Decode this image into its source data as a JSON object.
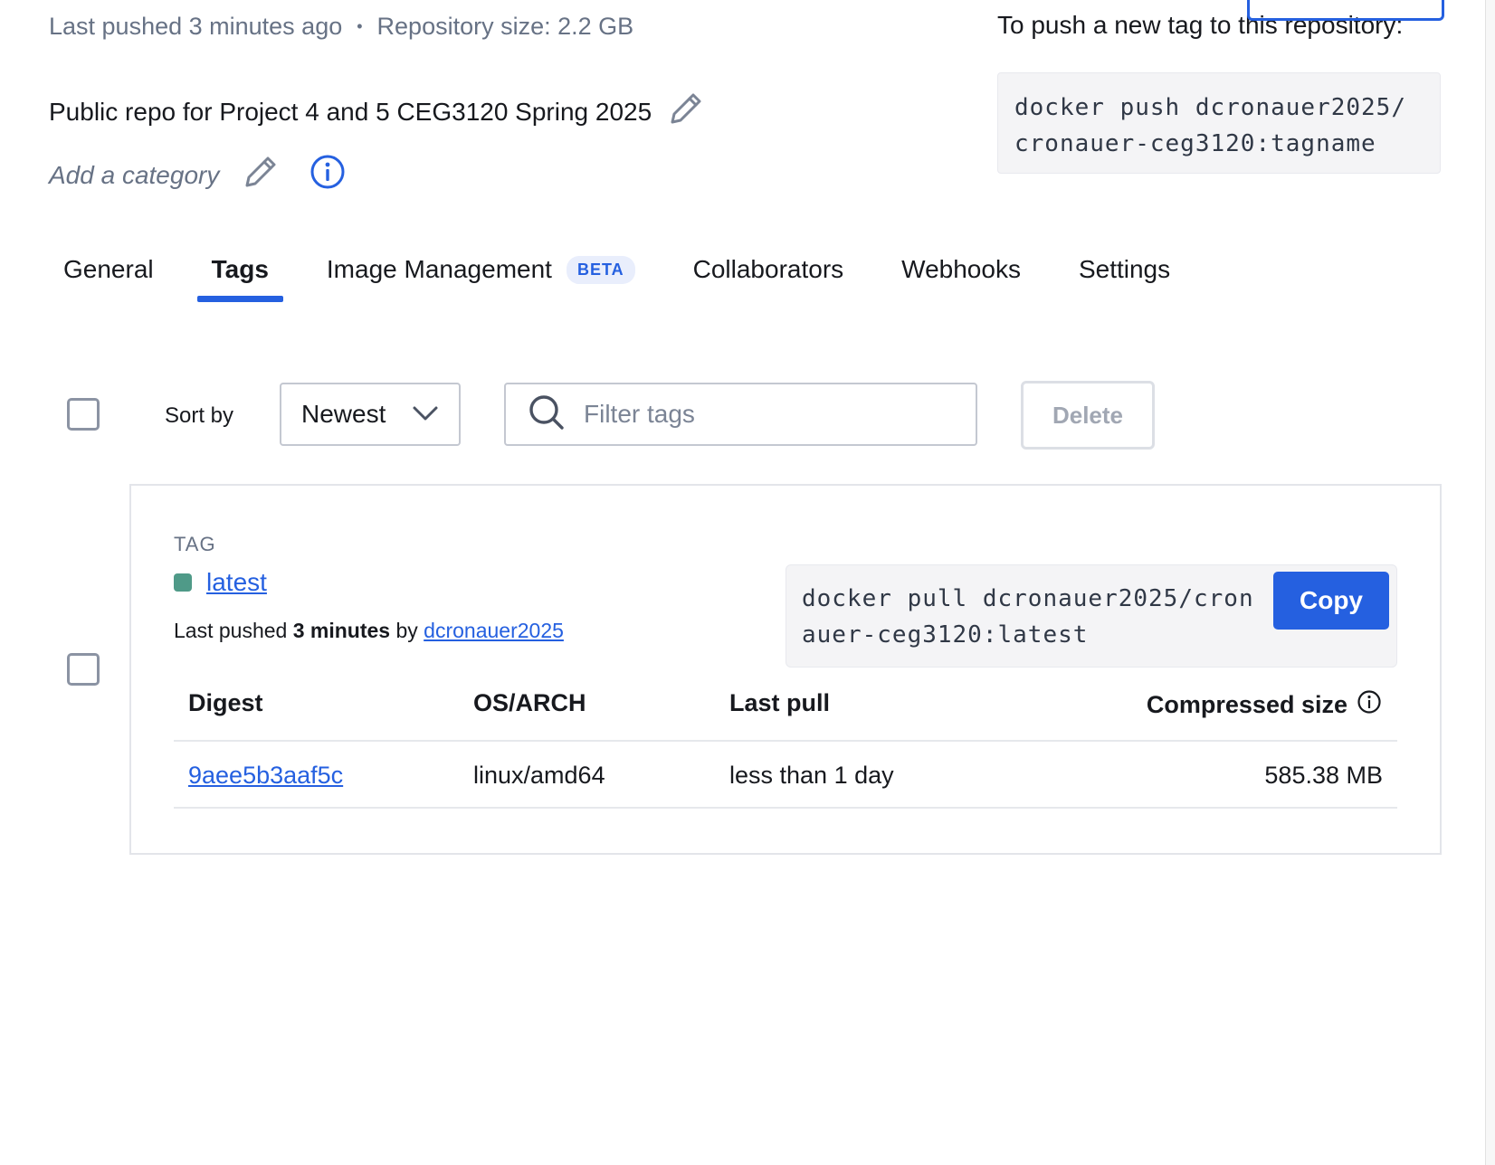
{
  "meta": {
    "last_pushed": "Last pushed 3 minutes ago",
    "separator": "•",
    "repo_size": "Repository size: 2.2 GB"
  },
  "repo": {
    "description": "Public repo for Project 4 and 5 CEG3120 Spring 2025",
    "category_placeholder": "Add a category"
  },
  "push": {
    "label": "To push a new tag to this repository:",
    "command": "docker push dcronauer2025/\ncronauer-ceg3120:tagname"
  },
  "tabs": [
    {
      "label": "General"
    },
    {
      "label": "Tags"
    },
    {
      "label": "Image Management",
      "badge": "BETA"
    },
    {
      "label": "Collaborators"
    },
    {
      "label": "Webhooks"
    },
    {
      "label": "Settings"
    }
  ],
  "toolbar": {
    "sort_label": "Sort by",
    "sort_value": "Newest",
    "filter_placeholder": "Filter tags",
    "delete_label": "Delete"
  },
  "tag": {
    "heading": "TAG",
    "name": "latest",
    "pushed_prefix": "Last pushed ",
    "pushed_time": "3 minutes",
    "pushed_by": " by ",
    "pushed_user": "dcronauer2025",
    "pull_command": "docker pull dcronauer2025/cronauer-ceg3120:latest",
    "copy_label": "Copy",
    "status_color": "#4f9a88"
  },
  "table": {
    "headers": {
      "digest": "Digest",
      "os_arch": "OS/ARCH",
      "last_pull": "Last pull",
      "compressed_size": "Compressed size"
    },
    "rows": [
      {
        "digest": "9aee5b3aaf5c",
        "os_arch": "linux/amd64",
        "last_pull": "less than 1 day",
        "size": "585.38 MB"
      }
    ]
  },
  "colors": {
    "accent": "#2560e0",
    "muted_text": "#677285"
  }
}
